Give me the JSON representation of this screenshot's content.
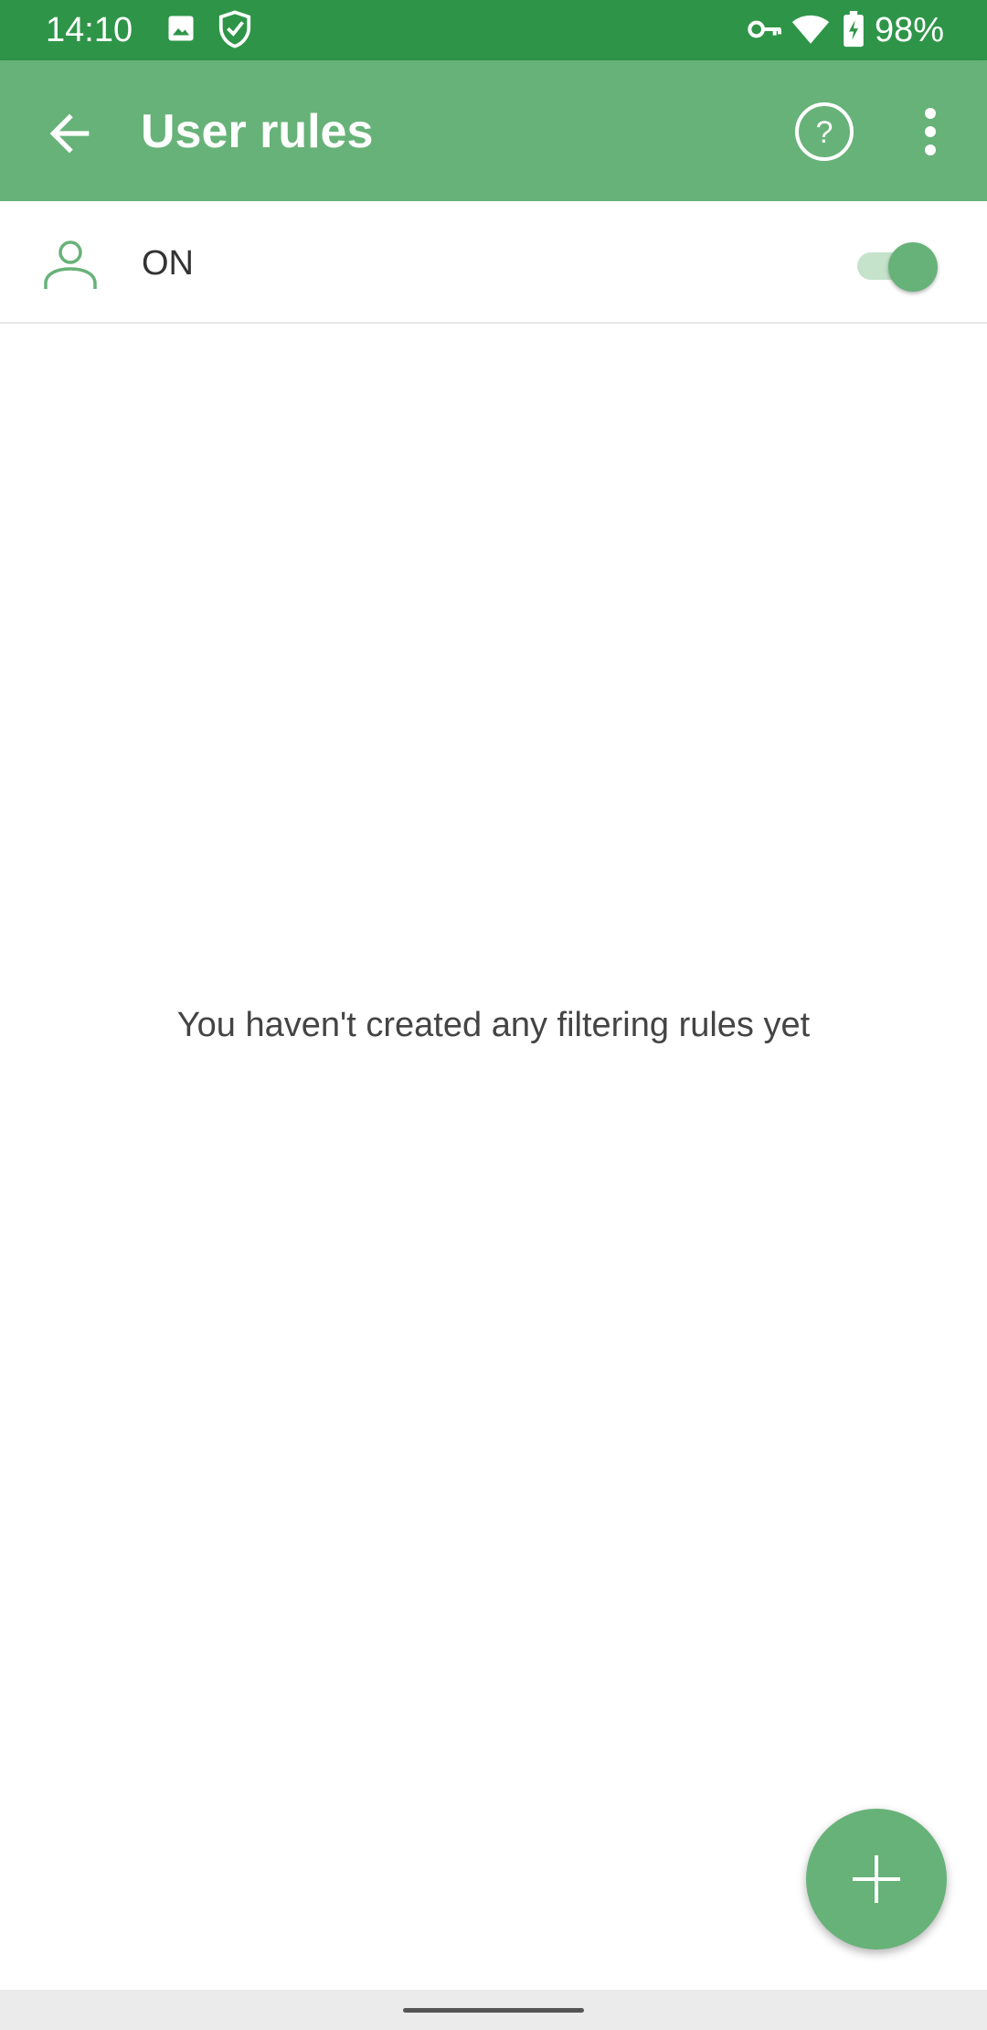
{
  "status_bar": {
    "time": "14:10",
    "battery_percent": "98%",
    "icons": [
      "image-icon",
      "adguard-shield-icon",
      "vpn-key-icon",
      "wifi-icon",
      "battery-charging-icon"
    ]
  },
  "app_bar": {
    "title": "User rules",
    "back_icon": "arrow-back-icon",
    "help_icon": "help-circle-icon",
    "more_icon": "more-vertical-icon"
  },
  "toggle_row": {
    "icon": "user-icon",
    "label": "ON",
    "enabled": true
  },
  "empty_state": {
    "message": "You haven't created any filtering rules yet"
  },
  "fab": {
    "icon": "plus-icon"
  },
  "colors": {
    "status_bar": "#2e9548",
    "app_bar": "#67b278",
    "accent": "#67b278",
    "switch_track": "#c5e2cb",
    "nav_bar": "#ebebeb"
  }
}
